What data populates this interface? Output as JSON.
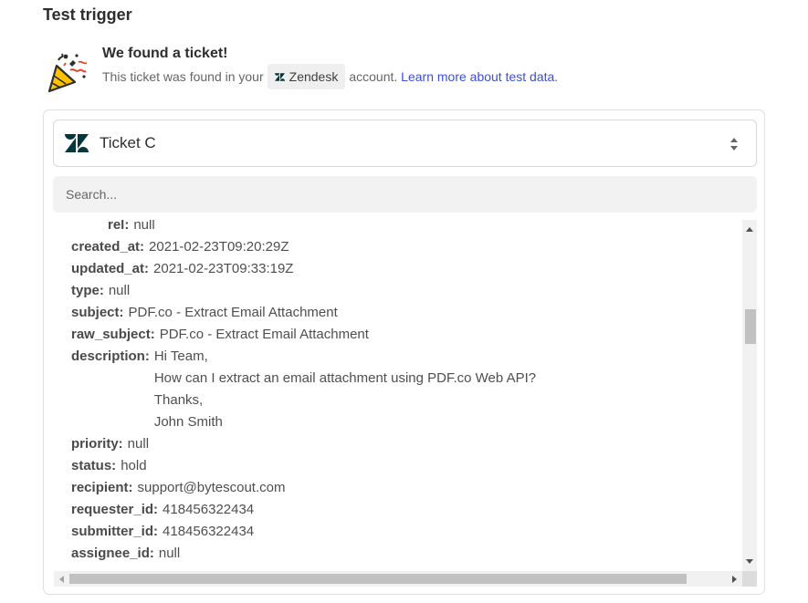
{
  "header": {
    "title": "Test trigger"
  },
  "found": {
    "title": "We found a ticket!",
    "text_before": "This ticket was found in your",
    "app_name": "Zendesk",
    "text_after": "account.",
    "learn_more": "Learn more about test data",
    "period": "."
  },
  "ticket_select": {
    "label": "Ticket C"
  },
  "search": {
    "placeholder": "Search..."
  },
  "fields": {
    "rel": {
      "key": "rel:",
      "value": "null"
    },
    "created_at": {
      "key": "created_at:",
      "value": "2021-02-23T09:20:29Z"
    },
    "updated_at": {
      "key": "updated_at:",
      "value": "2021-02-23T09:33:19Z"
    },
    "type": {
      "key": "type:",
      "value": "null"
    },
    "subject": {
      "key": "subject:",
      "value": "PDF.co - Extract Email Attachment"
    },
    "raw_subject": {
      "key": "raw_subject:",
      "value": "PDF.co - Extract Email Attachment"
    },
    "description": {
      "key": "description:",
      "lines": [
        "Hi Team,",
        "How can I extract an email attachment using PDF.co Web API?",
        "Thanks,",
        "John Smith"
      ]
    },
    "priority": {
      "key": "priority:",
      "value": "null"
    },
    "status": {
      "key": "status:",
      "value": "hold"
    },
    "recipient": {
      "key": "recipient:",
      "value": "support@bytescout.com"
    },
    "requester_id": {
      "key": "requester_id:",
      "value": "418456322434"
    },
    "submitter_id": {
      "key": "submitter_id:",
      "value": "418456322434"
    },
    "assignee_id": {
      "key": "assignee_id:",
      "value": "null"
    }
  },
  "colors": {
    "link": "#3d4fd1",
    "zendesk_brand": "#03363d",
    "party_yellow": "#ffc200"
  },
  "icons": {
    "party": "party-popper-icon",
    "zendesk": "zendesk-logo-icon",
    "select": "chevron-up-down-icon"
  }
}
